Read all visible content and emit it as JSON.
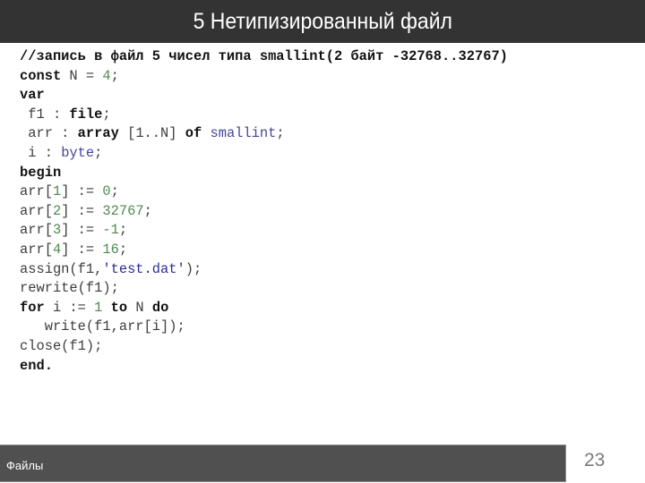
{
  "slide": {
    "title": "5 Нетипизированный файл",
    "footer_label": "Файлы",
    "page_number": "23"
  },
  "colors": {
    "header_bg": "#333333",
    "footer_bg": "#505050",
    "keyword": "#111111",
    "number": "#4e8a4e",
    "type": "#45459a",
    "string": "#2c2c9a",
    "text": "#3d3d3d"
  },
  "code": {
    "language": "pascal",
    "lines": [
      [
        {
          "t": "cmt",
          "v": "//запись в файл 5 чисел типа smallint(2 байт -32768..32767)"
        }
      ],
      [
        {
          "t": "kw",
          "v": "const"
        },
        {
          "t": "id",
          "v": " N = "
        },
        {
          "t": "num",
          "v": "4"
        },
        {
          "t": "id",
          "v": ";"
        }
      ],
      [
        {
          "t": "kw",
          "v": "var"
        }
      ],
      [
        {
          "t": "id",
          "v": " f1 : "
        },
        {
          "t": "kw",
          "v": "file"
        },
        {
          "t": "id",
          "v": ";"
        }
      ],
      [
        {
          "t": "id",
          "v": " arr : "
        },
        {
          "t": "kw",
          "v": "array"
        },
        {
          "t": "id",
          "v": " [1..N] "
        },
        {
          "t": "kw",
          "v": "of"
        },
        {
          "t": "id",
          "v": " "
        },
        {
          "t": "type",
          "v": "smallint"
        },
        {
          "t": "id",
          "v": ";"
        }
      ],
      [
        {
          "t": "id",
          "v": " i : "
        },
        {
          "t": "type",
          "v": "byte"
        },
        {
          "t": "id",
          "v": ";"
        }
      ],
      [
        {
          "t": "kw",
          "v": "begin"
        }
      ],
      [
        {
          "t": "id",
          "v": "arr["
        },
        {
          "t": "num",
          "v": "1"
        },
        {
          "t": "id",
          "v": "] := "
        },
        {
          "t": "num",
          "v": "0"
        },
        {
          "t": "id",
          "v": ";"
        }
      ],
      [
        {
          "t": "id",
          "v": "arr["
        },
        {
          "t": "num",
          "v": "2"
        },
        {
          "t": "id",
          "v": "] := "
        },
        {
          "t": "num",
          "v": "32767"
        },
        {
          "t": "id",
          "v": ";"
        }
      ],
      [
        {
          "t": "id",
          "v": "arr["
        },
        {
          "t": "num",
          "v": "3"
        },
        {
          "t": "id",
          "v": "] := "
        },
        {
          "t": "num",
          "v": "-1"
        },
        {
          "t": "id",
          "v": ";"
        }
      ],
      [
        {
          "t": "id",
          "v": "arr["
        },
        {
          "t": "num",
          "v": "4"
        },
        {
          "t": "id",
          "v": "] := "
        },
        {
          "t": "num",
          "v": "16"
        },
        {
          "t": "id",
          "v": ";"
        }
      ],
      [
        {
          "t": "id",
          "v": "assign(f1,"
        },
        {
          "t": "str",
          "v": "'test.dat'"
        },
        {
          "t": "id",
          "v": ");"
        }
      ],
      [
        {
          "t": "id",
          "v": "rewrite(f1);"
        }
      ],
      [
        {
          "t": "kw",
          "v": "for"
        },
        {
          "t": "id",
          "v": " i := "
        },
        {
          "t": "num",
          "v": "1"
        },
        {
          "t": "id",
          "v": " "
        },
        {
          "t": "kw",
          "v": "to"
        },
        {
          "t": "id",
          "v": " N "
        },
        {
          "t": "kw",
          "v": "do"
        }
      ],
      [
        {
          "t": "id",
          "v": "   write(f1,arr[i]);"
        }
      ],
      [
        {
          "t": "id",
          "v": "close(f1);"
        }
      ],
      [
        {
          "t": "kw",
          "v": "end."
        }
      ]
    ]
  }
}
